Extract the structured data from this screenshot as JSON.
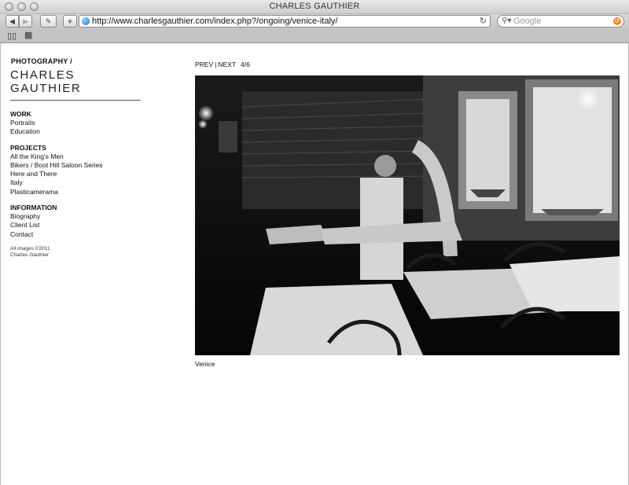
{
  "window": {
    "title": "CHARLES GAUTHIER"
  },
  "browser": {
    "url": "http://www.charlesgauthier.com/index.php?/ongoing/venice-italy/",
    "search_placeholder": "Google",
    "icons": [
      "back-icon",
      "forward-icon",
      "edit-icon",
      "add-bookmark-icon",
      "globe-icon",
      "reload-icon",
      "search-icon",
      "snapback-icon",
      "bookmarks-book-icon",
      "top-sites-grid-icon"
    ]
  },
  "site": {
    "kicker": "PHOTOGRAPHY /",
    "title": "CHARLES GAUTHIER"
  },
  "nav": {
    "work": {
      "heading": "WORK",
      "items": [
        "Portraits",
        "Education"
      ]
    },
    "projects": {
      "heading": "PROJECTS",
      "items": [
        "All the King's Men",
        "Bikers / Boot Hill Saloon Series",
        "Here and There",
        "Italy",
        "Plasticamerama"
      ]
    },
    "information": {
      "heading": "INFORMATION",
      "items": [
        "Biography",
        "Client List",
        "Contact"
      ]
    }
  },
  "copyright": {
    "line1": "All images ©2011",
    "line2": "Charles Gauthier"
  },
  "pager": {
    "prev": "PREV",
    "separator": "|",
    "next": "NEXT",
    "count": "4/6"
  },
  "photo": {
    "caption": "Venice"
  }
}
